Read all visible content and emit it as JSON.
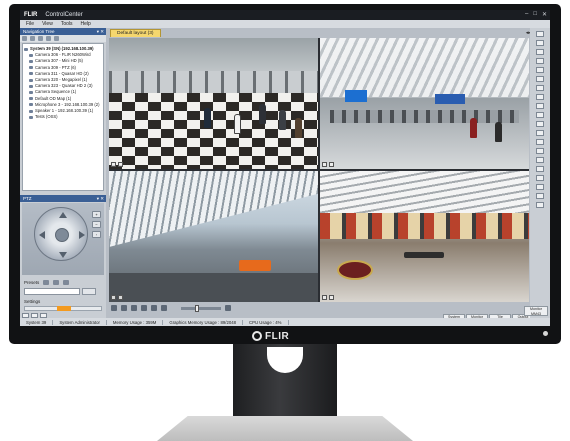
{
  "monitor": {
    "brand": "FLIR"
  },
  "app": {
    "logo": "FLIR",
    "title": "ControlCenter"
  },
  "menu": [
    "File",
    "View",
    "Tools",
    "Help"
  ],
  "navigation": {
    "title": "Navigation Tree",
    "items": [
      {
        "label": "System 39 (SN) (192.168.100.39)",
        "level": "root"
      },
      {
        "label": "Camera 306 - FLIR N260Wird",
        "level": "child"
      },
      {
        "label": "Camera 307 - Mini HD (5)",
        "level": "child"
      },
      {
        "label": "Camera 309 - PTZ (6)",
        "level": "child"
      },
      {
        "label": "Camera 311 - Quasar HD (2)",
        "level": "child"
      },
      {
        "label": "Camera 320 - Megapixel (1)",
        "level": "child"
      },
      {
        "label": "Camera 323 - Quasar HD 2 (3)",
        "level": "child"
      },
      {
        "label": "Camera Sequence (1)",
        "level": "child"
      },
      {
        "label": "Default OD Map (1)",
        "level": "child"
      },
      {
        "label": "Microphone 3 - 192.168.100.39 (2)",
        "level": "child"
      },
      {
        "label": "Speaker 1 - 192.168.100.39 (1)",
        "level": "child"
      },
      {
        "label": "Tests (OSS)",
        "level": "child"
      }
    ]
  },
  "ptz": {
    "title": "PTZ",
    "presets_label": "Presets",
    "settings_label": "Settings"
  },
  "layout_tab": {
    "label": "Default layout (3)"
  },
  "stats": [
    {
      "label": "System",
      "value": "39"
    },
    {
      "label": "Monitor",
      "value": "47"
    },
    {
      "label": "Tile",
      "value": "6"
    },
    {
      "label": "Output",
      "value": "5"
    }
  ],
  "monitor_box": {
    "label": "Monitor",
    "value": "MM43"
  },
  "statusbar": {
    "system": "System 39",
    "user": "System Administrator",
    "memory": "Memory Usage : 359M",
    "graphics": "Graphics Memory Usage : 89/2048",
    "cpu": "CPU Usage : 4%"
  }
}
